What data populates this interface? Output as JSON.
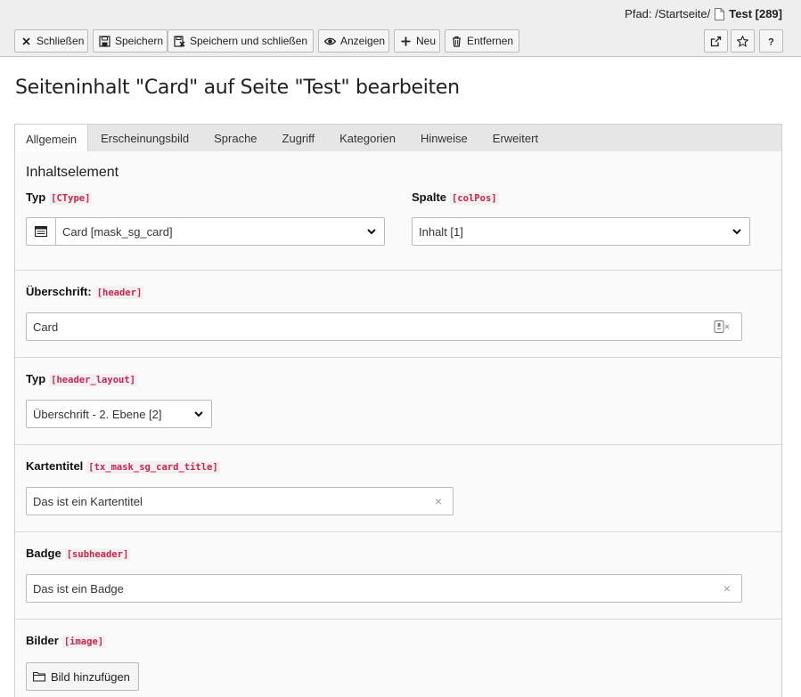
{
  "docheader": {
    "path_label": "Pfad: /Startseite/",
    "page_name": "Test [289]",
    "buttons": {
      "close": "Schließen",
      "save": "Speichern",
      "save_close": "Speichern und schließen",
      "view": "Anzeigen",
      "new": "Neu",
      "delete": "Entfernen"
    },
    "icons": [
      "close-icon",
      "save-icon",
      "save-close-icon",
      "eye-icon",
      "plus-icon",
      "trash-icon",
      "external-link-icon",
      "star-icon",
      "help-icon"
    ]
  },
  "title": "Seiteninhalt \"Card\" auf Seite \"Test\" bearbeiten",
  "tabs": [
    "Allgemein",
    "Erscheinungsbild",
    "Sprache",
    "Zugriff",
    "Kategorien",
    "Hinweise",
    "Erweitert"
  ],
  "form": {
    "section_title": "Inhaltselement",
    "ctype": {
      "label": "Typ",
      "field": "[CType]",
      "value": "Card [mask_sg_card]"
    },
    "colpos": {
      "label": "Spalte",
      "field": "[colPos]",
      "value": "Inhalt [1]"
    },
    "header": {
      "label": "Überschrift:",
      "field": "[header]",
      "value": "Card"
    },
    "header_layout": {
      "label": "Typ",
      "field": "[header_layout]",
      "value": "Überschrift - 2. Ebene [2]"
    },
    "card_title": {
      "label": "Kartentitel",
      "field": "[tx_mask_sg_card_title]",
      "value": "Das ist ein Kartentitel"
    },
    "subheader": {
      "label": "Badge",
      "field": "[subheader]",
      "value": "Das ist ein Badge"
    },
    "image": {
      "label": "Bilder",
      "field": "[image]",
      "button": "Bild hinzufügen"
    }
  },
  "clear_glyph": "×"
}
